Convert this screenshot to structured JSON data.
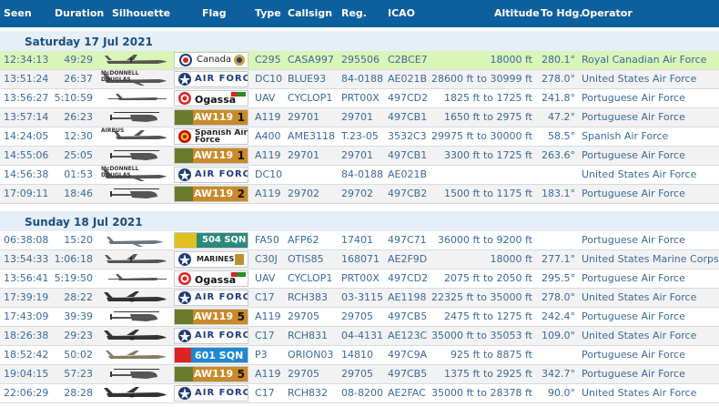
{
  "columns": {
    "seen": "Seen",
    "duration": "Duration",
    "silhouette": "Silhouette",
    "flag": "Flag",
    "type": "Type",
    "callsign": "Callsign",
    "reg": "Reg.",
    "icao": "ICAO",
    "altitude": "Altitude",
    "to_hdg": "To Hdg.",
    "operator": "Operator"
  },
  "days": [
    {
      "label": "Saturday 17 Jul 2021",
      "rows": [
        {
          "seen": "12:34:13",
          "duration": "49:29",
          "type": "C295",
          "callsign": "CASA997",
          "reg": "295506",
          "icao": "C2BCE7",
          "altitude": "18000 ft",
          "hdg": "280.1°",
          "operator": "Royal Canadian Air Force",
          "flag": "canada",
          "flag_text": "Canada",
          "plane": "turboprop",
          "highlight": true
        },
        {
          "seen": "13:51:24",
          "duration": "26:37",
          "type": "DC10",
          "callsign": "BLUE93",
          "reg": "84-0188",
          "icao": "AE021B",
          "altitude": "28600 ft to 30999 ft",
          "hdg": "278.0°",
          "operator": "United States Air Force",
          "flag": "usaf",
          "flag_text": "AIR FORCE",
          "plane": "jet-trijet",
          "silhouette_text": "McDONNELL DOUGLAS"
        },
        {
          "seen": "13:56:27",
          "duration": "5:10:59",
          "type": "UAV",
          "callsign": "CYCLOP1",
          "reg": "PRT00X",
          "icao": "497CD2",
          "altitude": "1825 ft to 1725 ft",
          "hdg": "241.8°",
          "operator": "Portuguese Air Force",
          "flag": "ogassa",
          "flag_text": "Ogassa",
          "plane": "uav"
        },
        {
          "seen": "13:57:14",
          "duration": "26:23",
          "type": "A119",
          "callsign": "29701",
          "reg": "29701",
          "icao": "497CB1",
          "altitude": "1650 ft to 2975 ft",
          "hdg": "47.2°",
          "operator": "Portuguese Air Force",
          "flag": "aw119",
          "flag_text": "AW119",
          "flag_num": "1",
          "plane": "heli"
        },
        {
          "seen": "14:24:05",
          "duration": "12:30",
          "type": "A400",
          "callsign": "AME3118",
          "reg": "T.23-05",
          "icao": "3532C3",
          "altitude": "29975 ft to 30000 ft",
          "hdg": "58.5°",
          "operator": "Spanish Air Force",
          "flag": "spain",
          "flag_text": "Spanish Air Force",
          "plane": "airbus",
          "silhouette_text": "AIRBUS"
        },
        {
          "seen": "14:55:06",
          "duration": "25:05",
          "type": "A119",
          "callsign": "29701",
          "reg": "29701",
          "icao": "497CB1",
          "altitude": "3300 ft to 1725 ft",
          "hdg": "263.6°",
          "operator": "Portuguese Air Force",
          "flag": "aw119",
          "flag_text": "AW119",
          "flag_num": "1",
          "plane": "heli"
        },
        {
          "seen": "14:56:38",
          "duration": "01:53",
          "type": "DC10",
          "callsign": "",
          "reg": "84-0188",
          "icao": "AE021B",
          "altitude": "",
          "hdg": "",
          "operator": "United States Air Force",
          "flag": "usaf",
          "flag_text": "AIR FORCE",
          "plane": "jet-trijet",
          "silhouette_text": "McDONNELL DOUGLAS"
        },
        {
          "seen": "17:09:11",
          "duration": "18:46",
          "type": "A119",
          "callsign": "29702",
          "reg": "29702",
          "icao": "497CB2",
          "altitude": "1500 ft to 1175 ft",
          "hdg": "183.1°",
          "operator": "Portuguese Air Force",
          "flag": "aw119",
          "flag_text": "AW119",
          "flag_num": "2",
          "plane": "heli"
        }
      ]
    },
    {
      "label": "Sunday 18 Jul 2021",
      "rows": [
        {
          "seen": "06:38:08",
          "duration": "15:20",
          "type": "FA50",
          "callsign": "AFP62",
          "reg": "17401",
          "icao": "497C71",
          "altitude": "36000 ft to 9200 ft",
          "hdg": "",
          "operator": "Portuguese Air Force",
          "flag": "sqn504",
          "flag_text": "504 SQN",
          "plane": "bizjet"
        },
        {
          "seen": "13:54:33",
          "duration": "1:06:18",
          "type": "C30J",
          "callsign": "OTIS85",
          "reg": "168071",
          "icao": "AE2F9D",
          "altitude": "18000 ft",
          "hdg": "277.1°",
          "operator": "United States Marine Corps",
          "flag": "marines",
          "flag_text": "MARINES",
          "plane": "turboprop"
        },
        {
          "seen": "13:56:41",
          "duration": "5:19:50",
          "type": "UAV",
          "callsign": "CYCLOP1",
          "reg": "PRT00X",
          "icao": "497CD2",
          "altitude": "2075 ft to 2050 ft",
          "hdg": "295.5°",
          "operator": "Portuguese Air Force",
          "flag": "ogassa",
          "flag_text": "Ogassa",
          "plane": "uav"
        },
        {
          "seen": "17:39:19",
          "duration": "28:22",
          "type": "C17",
          "callsign": "RCH383",
          "reg": "03-3115",
          "icao": "AE1198",
          "altitude": "22325 ft to 35000 ft",
          "hdg": "278.0°",
          "operator": "United States Air Force",
          "flag": "usaf",
          "flag_text": "AIR FORCE",
          "plane": "jet-heavy"
        },
        {
          "seen": "17:43:09",
          "duration": "39:39",
          "type": "A119",
          "callsign": "29705",
          "reg": "29705",
          "icao": "497CB5",
          "altitude": "2475 ft to 1275 ft",
          "hdg": "242.4°",
          "operator": "Portuguese Air Force",
          "flag": "aw119",
          "flag_text": "AW119",
          "flag_num": "5",
          "plane": "heli"
        },
        {
          "seen": "18:26:38",
          "duration": "29:23",
          "type": "C17",
          "callsign": "RCH831",
          "reg": "04-4131",
          "icao": "AE123C",
          "altitude": "35000 ft to 35053 ft",
          "hdg": "109.0°",
          "operator": "United States Air Force",
          "flag": "usaf",
          "flag_text": "AIR FORCE",
          "plane": "jet-heavy"
        },
        {
          "seen": "18:52:42",
          "duration": "50:02",
          "type": "P3",
          "callsign": "ORION03",
          "reg": "14810",
          "icao": "497C9A",
          "altitude": "925 ft to 8875 ft",
          "hdg": "",
          "operator": "Portuguese Air Force",
          "flag": "sqn601",
          "flag_text": "601 SQN",
          "plane": "p3"
        },
        {
          "seen": "19:04:15",
          "duration": "57:23",
          "type": "A119",
          "callsign": "29705",
          "reg": "29705",
          "icao": "497CB5",
          "altitude": "1375 ft to 2925 ft",
          "hdg": "342.7°",
          "operator": "Portuguese Air Force",
          "flag": "aw119",
          "flag_text": "AW119",
          "flag_num": "5",
          "plane": "heli"
        },
        {
          "seen": "22:06:29",
          "duration": "28:28",
          "type": "C17",
          "callsign": "RCH832",
          "reg": "08-8200",
          "icao": "AE2FAC",
          "altitude": "35000 ft to 28378 ft",
          "hdg": "90.0°",
          "operator": "United States Air Force",
          "flag": "usaf",
          "flag_text": "AIR FORCE",
          "plane": "jet-heavy"
        }
      ]
    }
  ],
  "colors": {
    "header": "#0e5f9e",
    "highlight_row": "#d9f5b8",
    "text": "#3a6a9a"
  }
}
